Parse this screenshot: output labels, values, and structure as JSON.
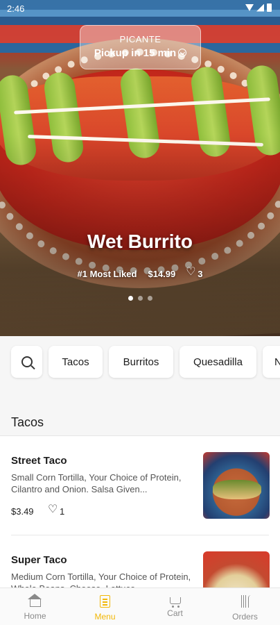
{
  "status_bar": {
    "time": "2:46"
  },
  "hero": {
    "restaurant": "PICANTE",
    "pickup": "Pickup in 15 min",
    "featured_title": "Wet Burrito",
    "badge": "#1 Most Liked",
    "price": "$14.99",
    "likes": "3",
    "carousel": {
      "count": 3,
      "active_index": 0
    }
  },
  "categories": {
    "search_icon": "search-icon",
    "items": [
      "Tacos",
      "Burritos",
      "Quesadilla",
      "N"
    ]
  },
  "section": {
    "title": "Tacos"
  },
  "menu_items": [
    {
      "name": "Street Taco",
      "description": "Small Corn Tortilla, Your Choice of Protein, Cilantro and Onion. Salsa Given...",
      "price": "$3.49",
      "likes": "1"
    },
    {
      "name": "Super Taco",
      "description": "Medium Corn Tortilla, Your Choice of Protein, Whole Beans, Cheese, Lettuce...",
      "price": "",
      "likes": ""
    }
  ],
  "bottom_nav": {
    "items": [
      {
        "label": "Home",
        "icon": "home-icon",
        "active": false
      },
      {
        "label": "Menu",
        "icon": "menu-icon",
        "active": true
      },
      {
        "label": "Cart",
        "icon": "cart-icon",
        "active": false
      },
      {
        "label": "Orders",
        "icon": "orders-icon",
        "active": false
      }
    ]
  },
  "colors": {
    "accent": "#f2b705",
    "text": "#1c1c1c",
    "muted": "#8a8a8a"
  }
}
